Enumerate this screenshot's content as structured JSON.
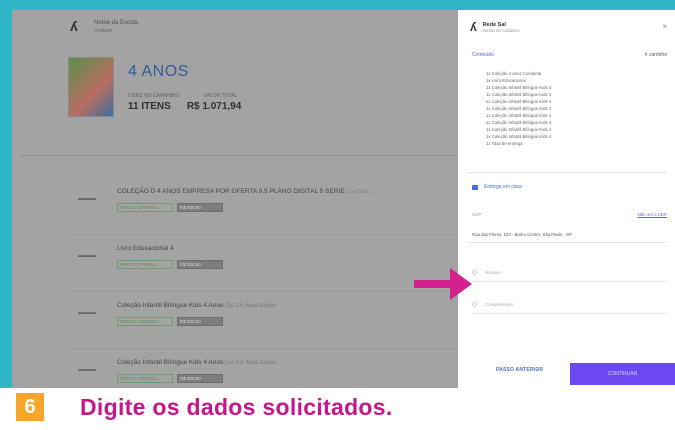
{
  "brand": {
    "name": "Nome da Escola",
    "sub": "Unidade"
  },
  "cart": {
    "age": "4 ANOS",
    "items_label": "ITENS NO CARRINHO",
    "total_label": "VALOR TOTAL",
    "items": "11 ITENS",
    "total": "R$ 1.071,94"
  },
  "items": [
    {
      "thumb": "▬▬▬",
      "title": "COLEÇÃO D 4 ANOS EMPRESA POR OFERTA 8.5 PLANO DIGITAL 5 SERIE",
      "extra": "(1x) Cod...",
      "tag1": "PRECO ORIGINAL",
      "tag2": "R$ 000,00"
    },
    {
      "thumb": "▬▬▬",
      "title": "Livro Educacional 4",
      "extra": "",
      "tag1": "PRECO ORIGINAL",
      "tag2": "R$ 000,00"
    },
    {
      "thumb": "▬▬▬",
      "title": "Coleção Infantil Bilíngue Kids 4 Anos",
      "extra": "(1x) Ed. Atual Edição",
      "tag1": "PRECO ORIGINAL",
      "tag2": "R$ 000,00"
    },
    {
      "thumb": "▬▬▬",
      "title": "Coleção Infantil Bilíngue Kids 4 Anos",
      "extra": "(1x) Ed. Atual Edição",
      "tag1": "PRECO ORIGINAL",
      "tag2": "R$ 000,00"
    }
  ],
  "panel": {
    "title": "Rede Sal",
    "subtitle": "Conta de cadastro",
    "close": "×",
    "summary_link": "Conteúdo",
    "summary_right": "Ir carrinho",
    "links": [
      "1x  Coleção 4 anos Completa",
      "1x  Livro Educacional",
      "1x  Coleção Infantil Bilíngue Kids 4",
      "1x  Coleção Infantil Bilíngue Kids 4",
      "1x  Coleção Infantil Bilíngue Kids 4",
      "1x  Coleção Infantil Bilíngue Kids 4",
      "1x  Coleção Infantil Bilíngue Kids 4",
      "1x  Coleção Infantil Bilíngue Kids 4",
      "1x  Coleção Infantil Bilíngue Kids 4",
      "1x  Coleção Infantil Bilíngue Kids 4",
      "1x  Taxa de entrega"
    ],
    "section": "Entrega em casa",
    "field_label": "CEP",
    "field_link": "Não sei o CEP",
    "field_value": "Rua das Flores, 123 - Bairro Centro, São Paulo - SP",
    "input1": "Número",
    "input2": "Complemento",
    "prev": "PASSO ANTERIOR",
    "next": "CONTINUAR"
  },
  "caption": {
    "step": "6",
    "text": "Digite os dados solicitados."
  },
  "colors": {
    "teal": "#2fb7c7",
    "magenta": "#c5168c",
    "purple": "#6c48f0",
    "orange": "#f7a62b"
  }
}
